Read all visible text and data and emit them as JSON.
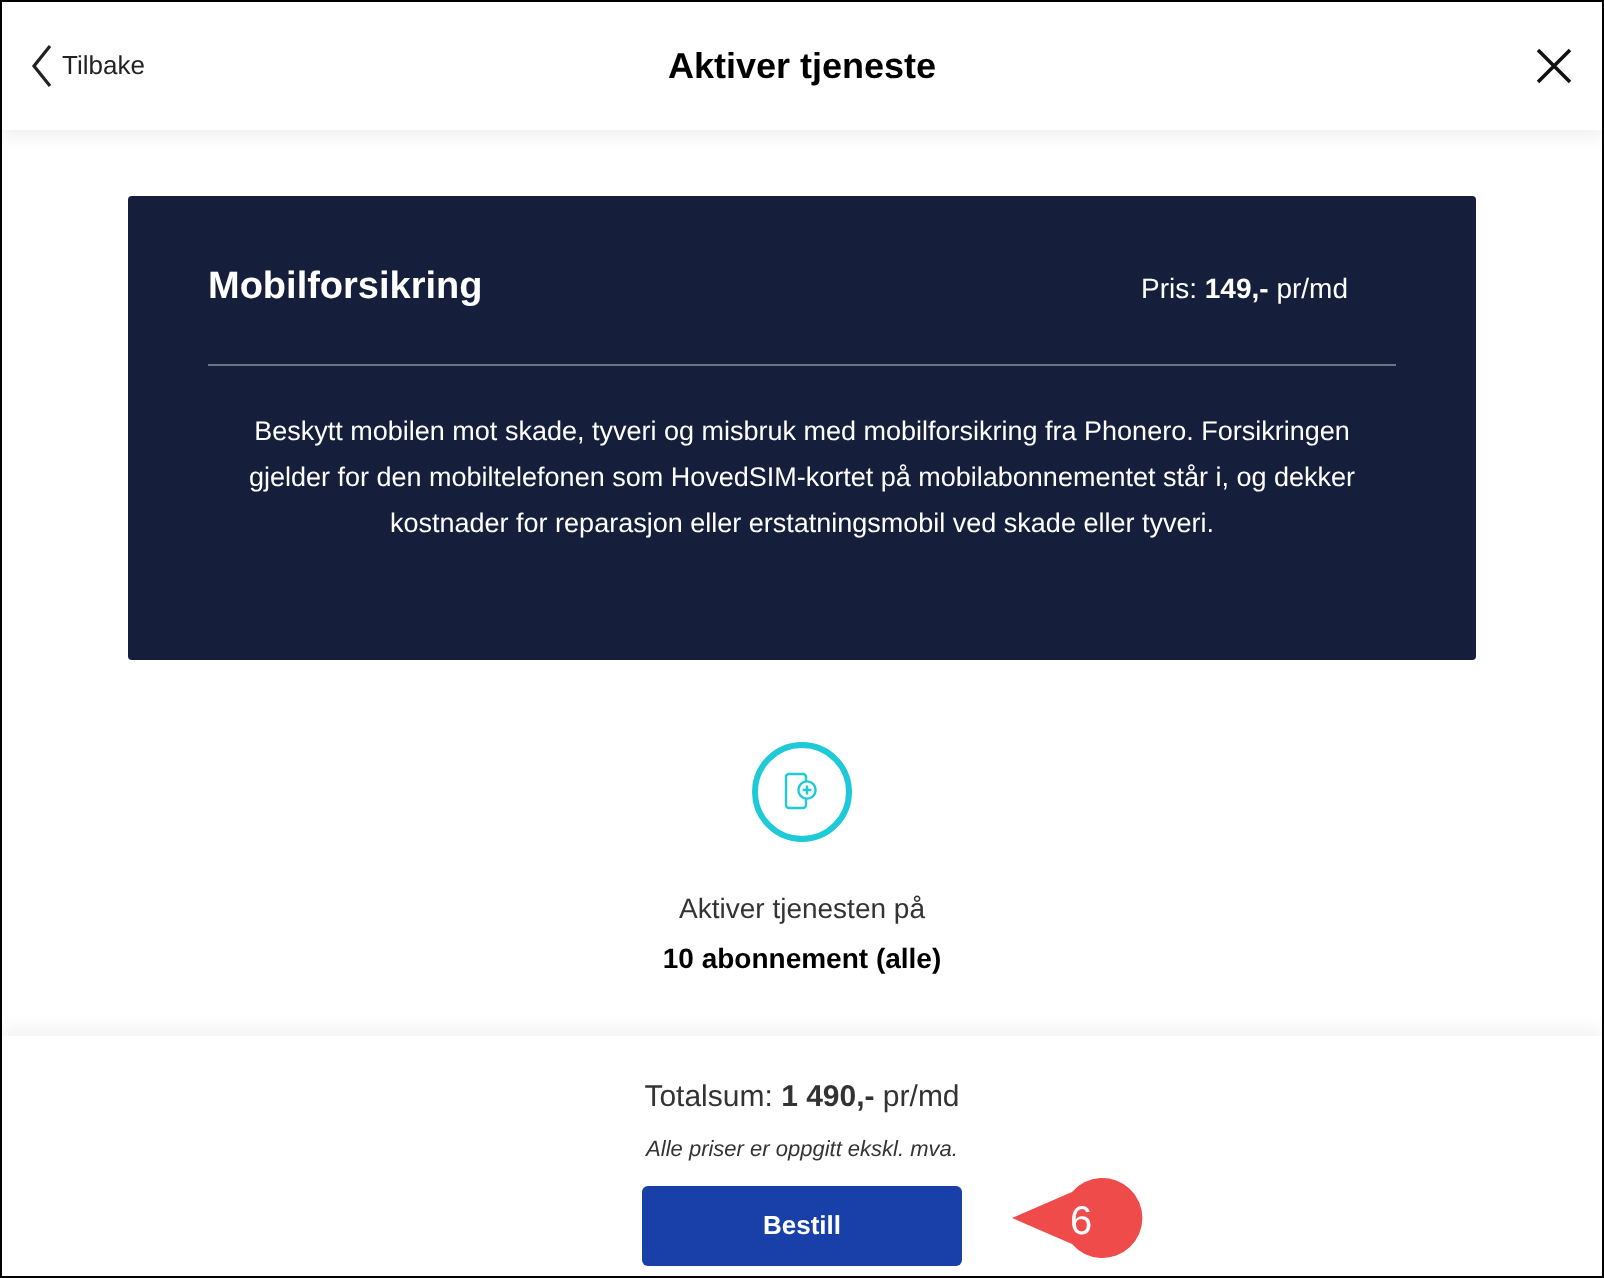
{
  "header": {
    "back": "Tilbake",
    "title": "Aktiver tjeneste"
  },
  "card": {
    "name": "Mobilforsikring",
    "price": "Pris: **149,-** pr/md",
    "description": "Beskytt mobilen mot skade, tyveri og misbruk med mobilforsikring fra Phonero. Forsikringen gjelder for den mobiltelefonen som HovedSIM-kortet på mobilabonnementet står i, og dekker kostnader for reparasjon eller erstatningsmobil ved skade eller tyveri."
  },
  "activation": {
    "label": "Aktiver tjenesten på",
    "value": "10 abonnement (alle)"
  },
  "footer": {
    "total": "Totalsum: **1 490,-** pr/md",
    "note": "Alle priser er oppgitt ekskl. mva.",
    "button": "Bestill"
  },
  "callout": {
    "number": "6"
  }
}
